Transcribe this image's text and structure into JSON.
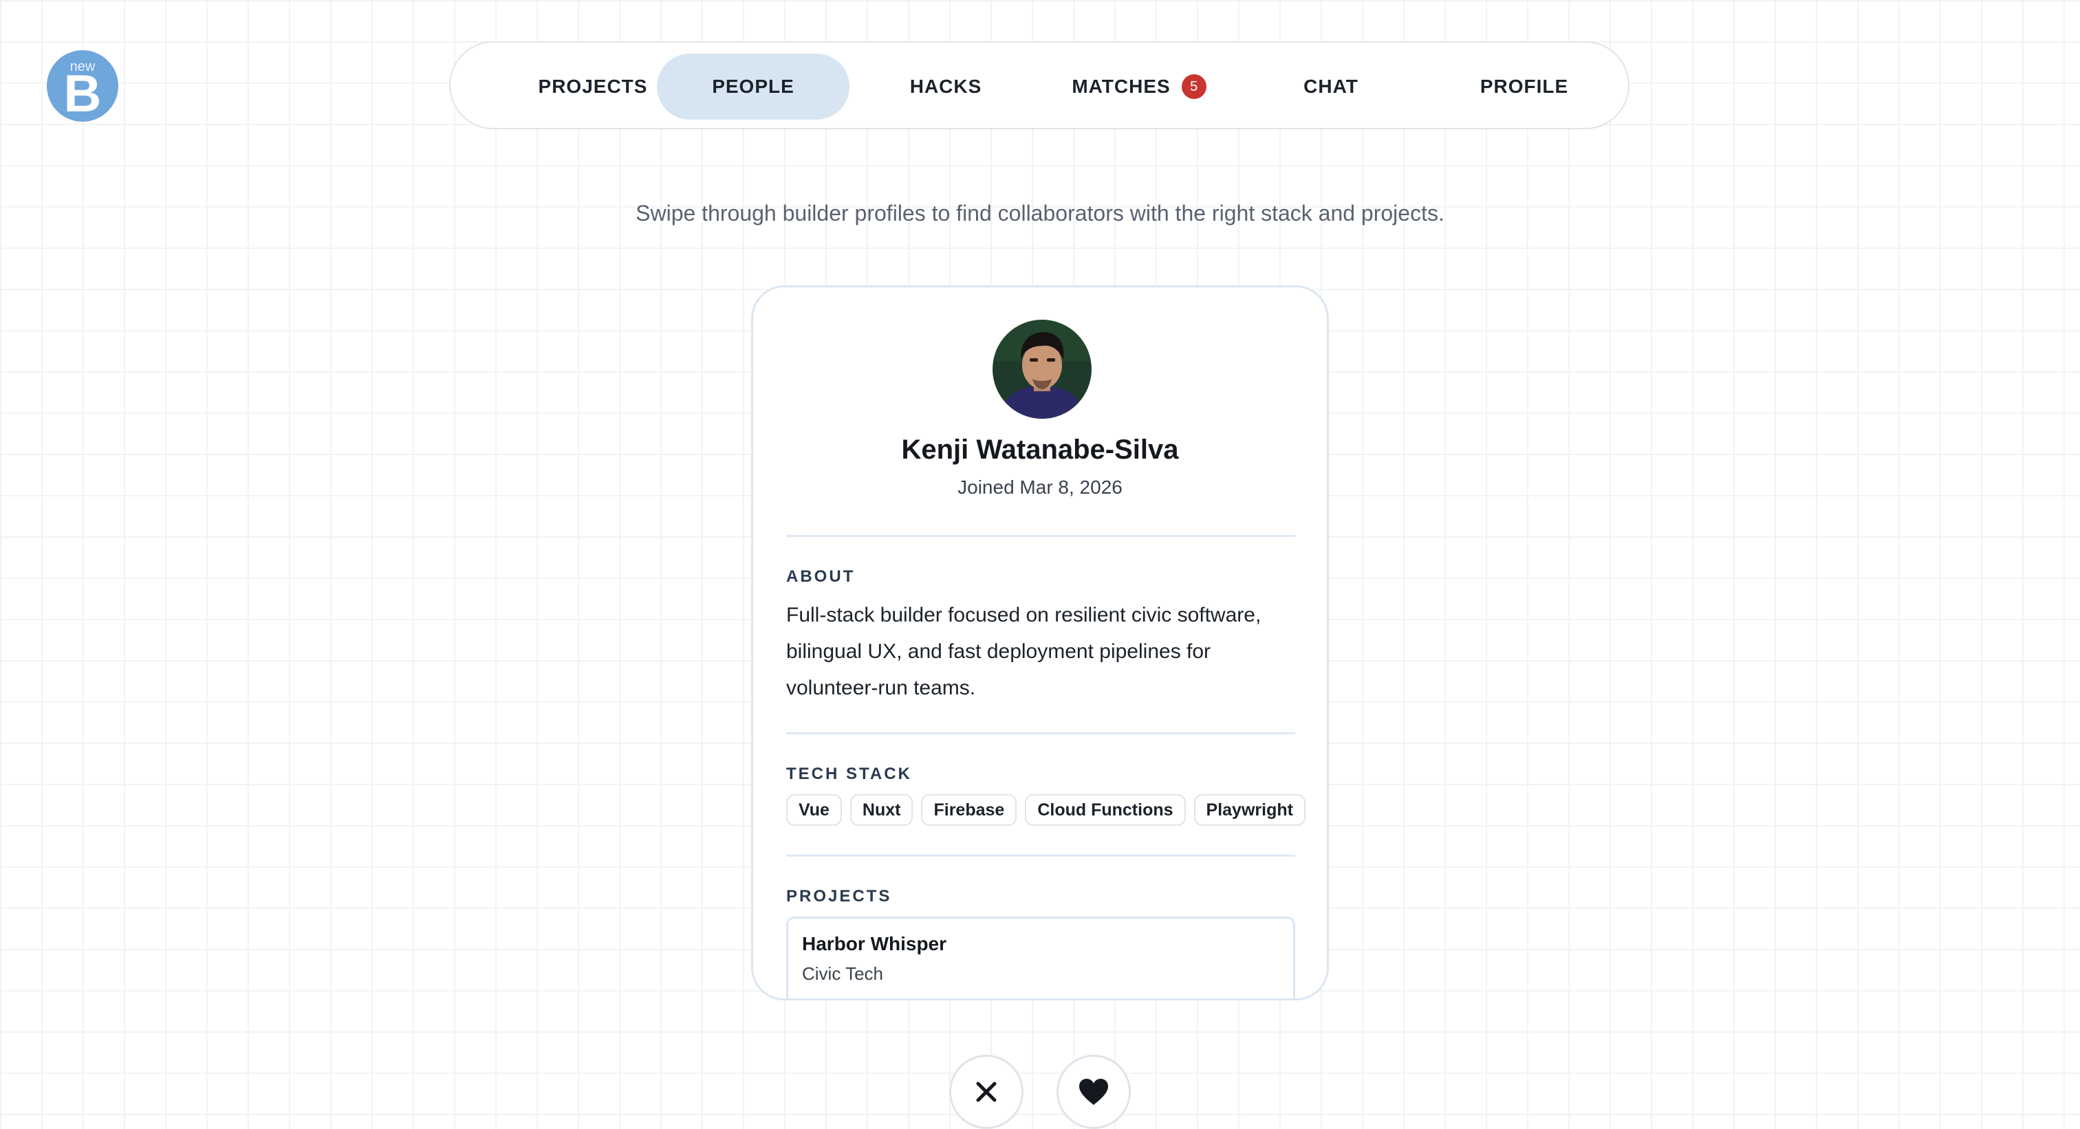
{
  "logo": {
    "small_text": "new",
    "letter": "B",
    "color": "#6fa6dc"
  },
  "nav": {
    "tabs": [
      {
        "label": "PROJECTS",
        "active": false
      },
      {
        "label": "PEOPLE",
        "active": true
      },
      {
        "label": "HACKS",
        "active": false
      },
      {
        "label": "MATCHES",
        "active": false,
        "badge": "5"
      },
      {
        "label": "CHAT",
        "active": false
      },
      {
        "label": "PROFILE",
        "active": false
      }
    ],
    "active_color": "#d6e5f1",
    "badge_color": "#c8352e"
  },
  "subtitle": "Swipe through builder profiles to find collaborators with the right stack and projects.",
  "profile": {
    "avatar_icon": "user-photo",
    "name": "Kenji Watanabe-Silva",
    "joined": "Joined Mar 8, 2026",
    "about_label": "ABOUT",
    "about_text": "Full-stack builder focused on resilient civic software, bilingual UX, and fast deployment pipelines for volunteer-run teams.",
    "tech_stack_label": "TECH STACK",
    "tech_stack": [
      "Vue",
      "Nuxt",
      "Firebase",
      "Cloud Functions",
      "Playwright"
    ],
    "projects_label": "PROJECTS",
    "projects": [
      {
        "title": "Harbor Whisper",
        "category": "Civic Tech"
      }
    ]
  },
  "actions": {
    "pass_icon": "close-icon",
    "like_icon": "heart-icon"
  }
}
